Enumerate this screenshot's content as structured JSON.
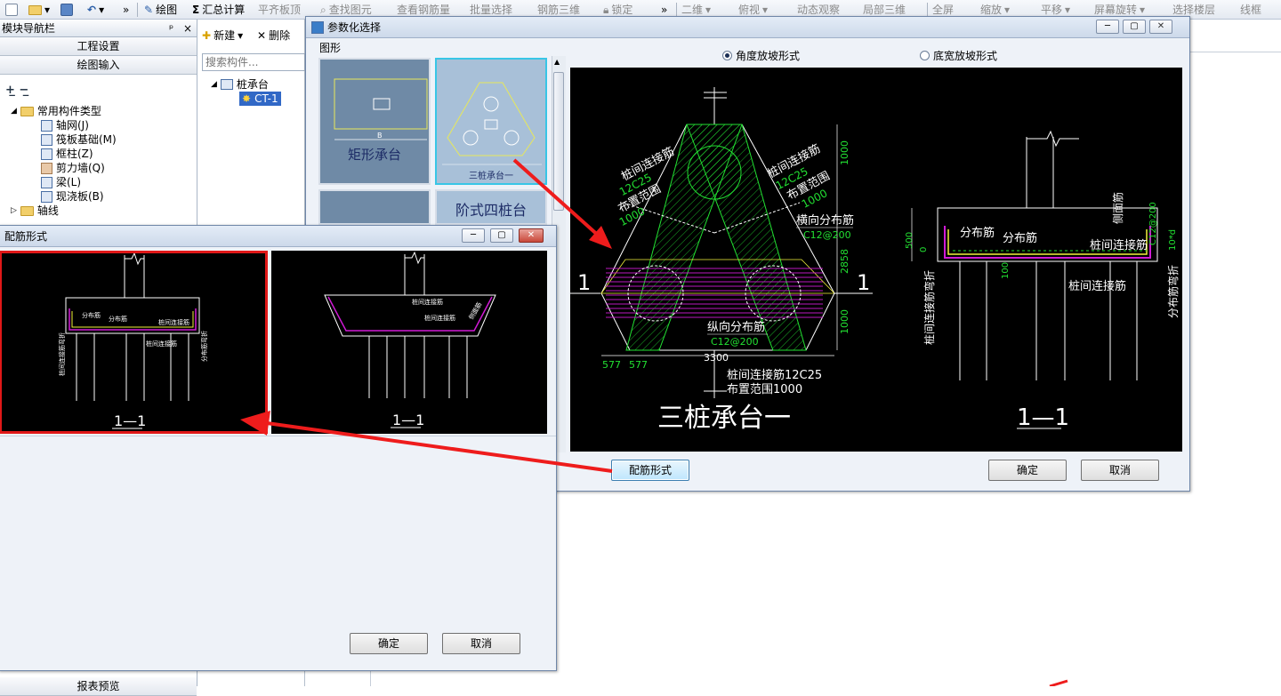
{
  "toolbar": {
    "items": [
      "绘图",
      "汇总计算",
      "平齐板顶",
      "查找图元",
      "查看钢筋量",
      "批量选择",
      "钢筋三维",
      "锁定",
      "二维",
      "俯视",
      "动态观察",
      "局部三维",
      "全屏",
      "缩放",
      "平移",
      "屏幕旋转",
      "选择楼层",
      "线框"
    ],
    "sigma": "Σ",
    "more": "»"
  },
  "nav": {
    "title": "模块导航栏",
    "pin": "ᵖ",
    "close": "×",
    "btn_project": "工程设置",
    "btn_draw": "绘图输入",
    "tree": {
      "group": "常用构件类型",
      "items": [
        "轴网(J)",
        "筏板基础(M)",
        "框柱(Z)",
        "剪力墙(Q)",
        "梁(L)",
        "现浇板(B)"
      ],
      "axis": "轴线"
    },
    "bottom_label": "报表预览"
  },
  "mid": {
    "new_label": "新建",
    "delete_label": "删除",
    "search_placeholder": "搜索构件...",
    "tree_root": "桩承台",
    "tree_child": "CT-1"
  },
  "param_dialog": {
    "title": "参数化选择",
    "section_label": "图形",
    "radio_angle": "角度放坡形式",
    "radio_width": "底宽放坡形式",
    "thumbs": [
      "矩形承台",
      "三桩承台一",
      "阶式四桩台"
    ],
    "btn_rebar_form": "配筋形式",
    "btn_ok": "确定",
    "btn_cancel": "取消",
    "cad": {
      "title": "三桩承台一",
      "section": "1—1",
      "marker": "1",
      "labels": {
        "connect1": "桩间连接筋",
        "c12c25": "12C25",
        "range1": "布置范围",
        "v1000": "1000",
        "connect2": "桩间连接筋",
        "c12c25b": "12C25",
        "range2": "布置范围",
        "v1000b": "1000",
        "horiz": "横向分布筋",
        "horiz_spec": "C12@200",
        "vert": "纵向分布筋",
        "vert_spec": "C12@200",
        "bottom_connect": "桩间连接筋12C25",
        "bottom_range": "布置范围1000",
        "dim_577a": "577",
        "dim_577b": "577",
        "dim_3300": "3300",
        "dim_1000top": "1000",
        "dim_2858": "2858",
        "dim_1000bot": "1000",
        "s_dist1": "分布筋",
        "s_dist2": "分布筋",
        "s_side": "侧面筋",
        "s_side_spec": "C12@200",
        "s_connect": "桩间连接筋",
        "s_connect2": "桩间连接筋",
        "s_500": "500",
        "s_0": "0",
        "s_100": "100",
        "s_10d": "10*d",
        "s_bend": "桩间连接筋弯折",
        "s_dist_bend": "分布筋弯折"
      }
    }
  },
  "rebar_dialog": {
    "title": "配筋形式",
    "btn_ok": "确定",
    "btn_cancel": "取消",
    "panel1": {
      "section": "1—1",
      "l_dist1": "分布筋",
      "l_dist2": "分布筋",
      "l_connect": "桩间连接筋",
      "l_connect2": "桩间连接筋",
      "l_bend": "桩间连接筋弯折",
      "l_dist_bend": "分布筋弯折"
    },
    "panel2": {
      "section": "1—1",
      "l_connect": "桩间连接筋",
      "l_connect2": "桩间连接筋",
      "l_side": "侧面筋"
    }
  },
  "colors": {
    "cad_bg": "#000000",
    "cad_green": "#22e032",
    "cad_magenta": "#d11ad6",
    "cad_yellow": "#f2f23a",
    "arrow_red": "#ee1c1c"
  }
}
